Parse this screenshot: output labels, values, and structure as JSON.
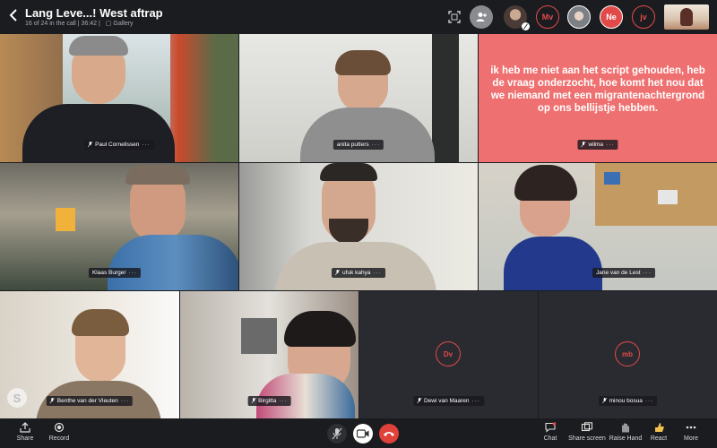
{
  "window": {
    "title": "Lang Leve...! West aftrap",
    "call_status": "16 of 24 in the call",
    "duration": "36:42",
    "view_mode": "Gallery"
  },
  "top_participants": [
    {
      "initials": "Mv"
    },
    {
      "initials": "Ne"
    },
    {
      "initials": "jv"
    }
  ],
  "tiles": [
    {
      "name": "Paul Cornelissen"
    },
    {
      "name": "anita putters"
    },
    {
      "name": "wilma",
      "caption": "ik heb me niet aan het script gehouden, heb de vraag onderzocht, hoe komt het nou dat we niemand met een migrantenachtergrond op ons bellijstje hebben."
    },
    {
      "name": "Klaas Burger"
    },
    {
      "name": "ufuk kahya"
    },
    {
      "name": "Jane van de Lest"
    },
    {
      "name": "Benthe van der Vleuten"
    },
    {
      "name": "Birgitta"
    },
    {
      "name": "Dewi van Maaren",
      "initials": "Dv"
    },
    {
      "name": "minou bosua",
      "initials": "mb"
    }
  ],
  "bottom": {
    "share": "Share",
    "record": "Record",
    "chat": "Chat",
    "share_screen": "Share screen",
    "raise_hand": "Raise Hand",
    "react": "React",
    "more": "More"
  },
  "colors": {
    "accent_red": "#e24a4a",
    "caption_tile": "#ef7070",
    "end_call": "#e0413a"
  },
  "icons": [
    "chevron-left-icon",
    "fullscreen-icon",
    "add-person-icon",
    "mic-off-icon",
    "video-icon",
    "hang-up-icon",
    "share-icon",
    "record-icon",
    "chat-icon",
    "share-screen-icon",
    "raise-hand-icon",
    "react-icon",
    "more-icon"
  ]
}
